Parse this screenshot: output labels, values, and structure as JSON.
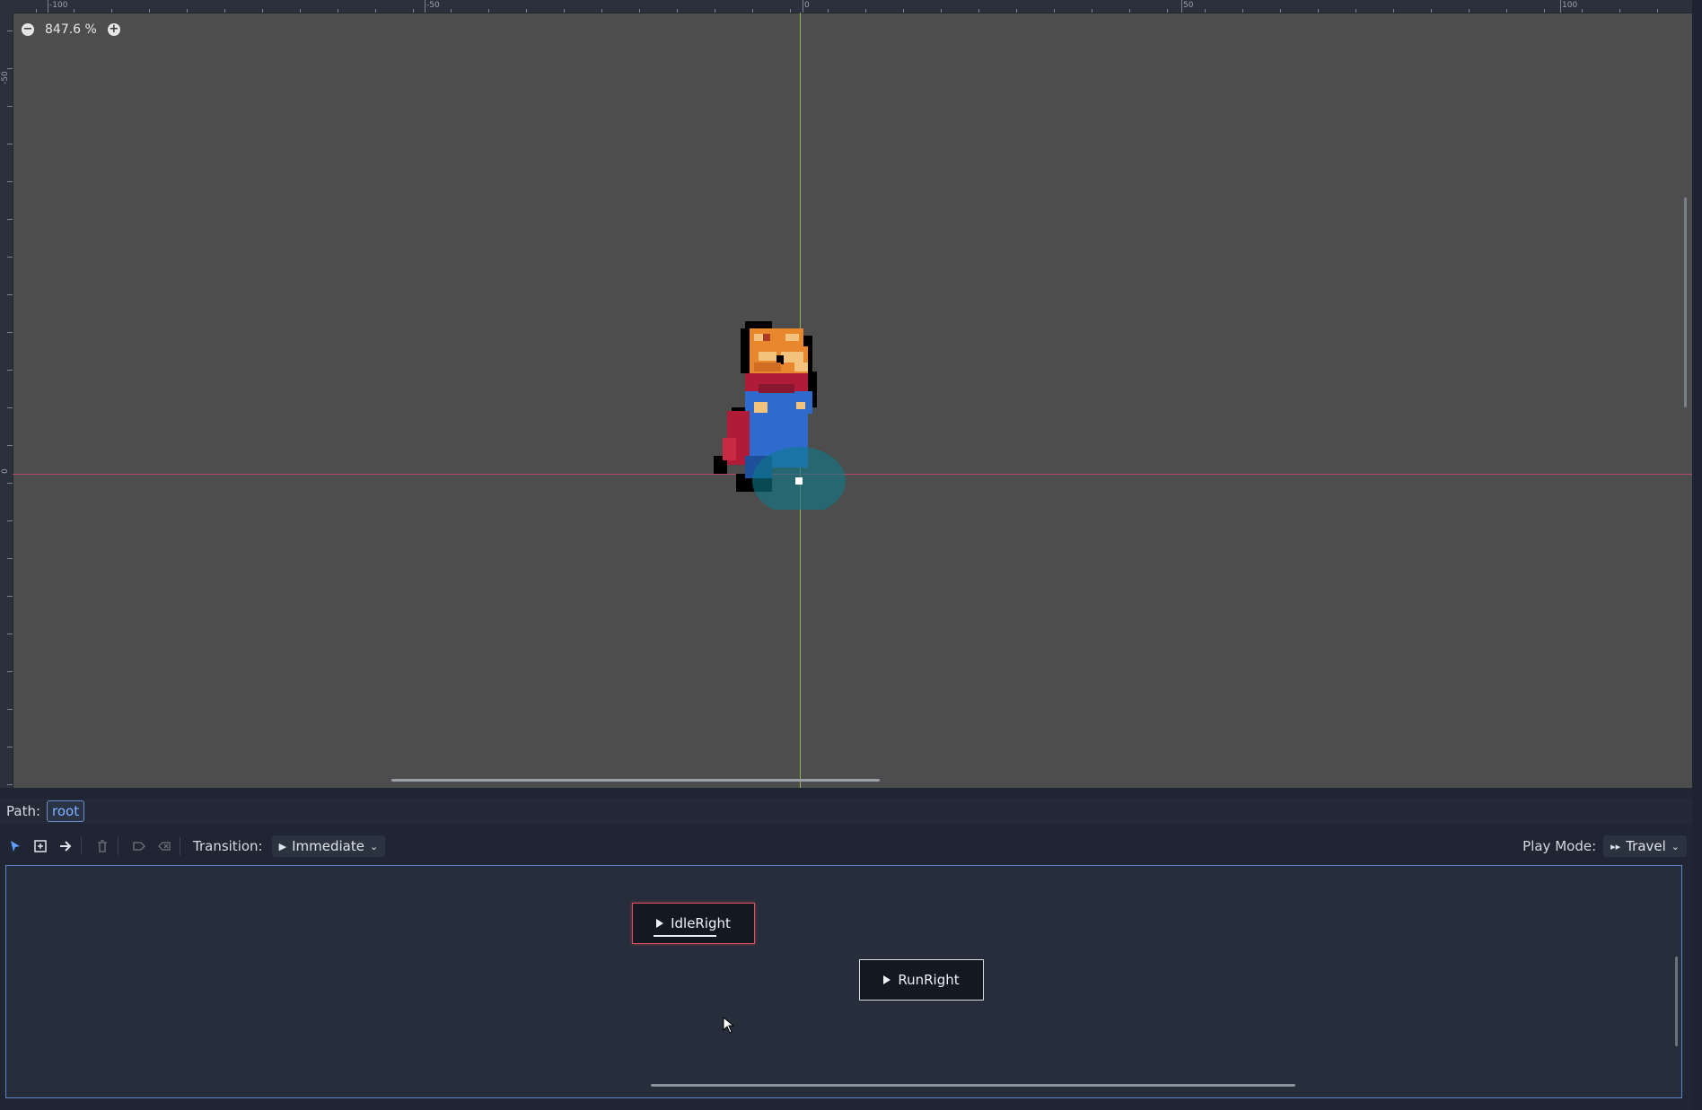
{
  "viewport": {
    "zoom": {
      "label": "847.6 %",
      "zoom_out_icon": "minus-circle-icon",
      "zoom_in_icon": "plus-circle-icon"
    },
    "ruler_top_labels": [
      "-100",
      "-50",
      "0",
      "50",
      "100"
    ],
    "ruler_left_labels": [
      "-50",
      "0"
    ],
    "colors": {
      "background": "#4d4d4d",
      "x_axis": "#b64a66",
      "y_axis": "#8fb04a"
    }
  },
  "path_bar": {
    "label": "Path:",
    "root": "root"
  },
  "toolbar": {
    "tools": [
      {
        "name": "select-tool-icon"
      },
      {
        "name": "create-node-icon"
      },
      {
        "name": "connect-nodes-icon"
      },
      {
        "name": "delete-icon"
      },
      {
        "name": "set-end-icon"
      },
      {
        "name": "remove-icon"
      }
    ],
    "transition_label": "Transition:",
    "transition_value": "Immediate",
    "play_mode_label": "Play Mode:",
    "play_mode_value": "Travel"
  },
  "graph": {
    "nodes": [
      {
        "label": "IdleRight",
        "state": "playing"
      },
      {
        "label": "RunRight",
        "state": "idle"
      }
    ]
  }
}
